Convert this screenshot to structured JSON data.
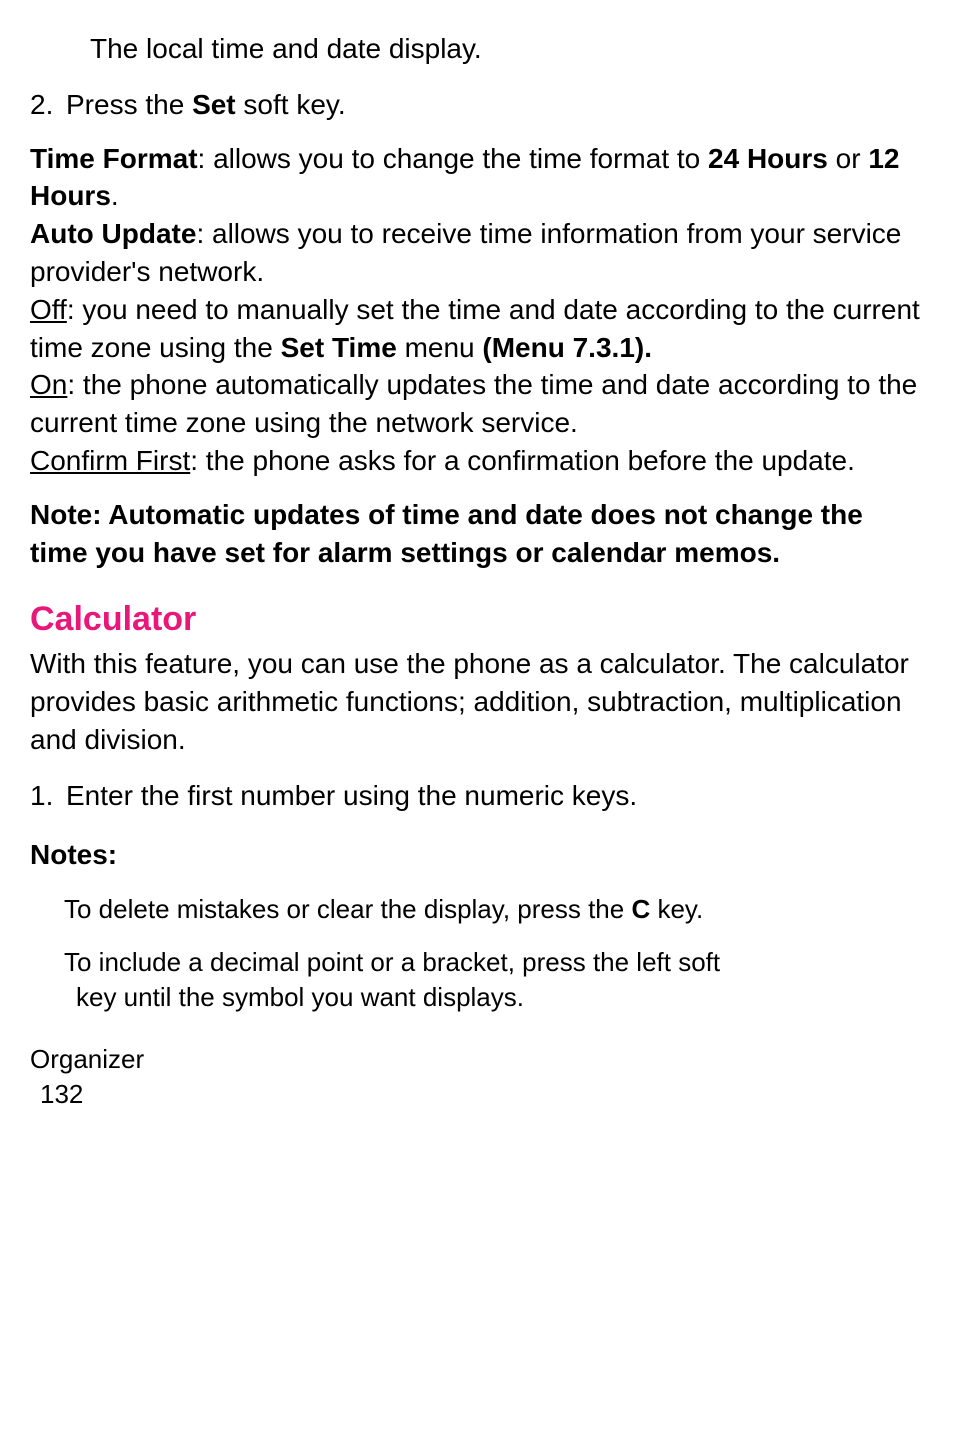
{
  "intro_line": "The local time and date display.",
  "step2": {
    "num": "2.",
    "prefix": "Press the ",
    "set": "Set",
    "suffix": " soft key."
  },
  "time_format": {
    "label": "Time Format",
    "text1": ": allows you to change the time format to ",
    "h24": "24 Hours",
    "or": " or ",
    "h12": "12 Hours",
    "period": "."
  },
  "auto_update": {
    "label": "Auto Update",
    "text": ": allows you to receive time information from your service provider's network."
  },
  "off": {
    "label": "Off",
    "text1": ": you need to manually set the time and date according to the current time zone using the ",
    "settime": "Set Time",
    "text2": " menu ",
    "menu": "(Menu 7.3.1)."
  },
  "on": {
    "label": "On",
    "text": ": the phone automatically updates the time and date according to the current time zone using the network service."
  },
  "confirm": {
    "label": "Confirm First",
    "text": ": the phone asks for a confirmation before the update."
  },
  "note_block": "Note:  Automatic updates of time and date does not change the time you have set for alarm settings or calendar memos.",
  "calculator": {
    "heading": "Calculator",
    "desc": "With this feature, you can use the phone as a calculator. The calculator provides basic arithmetic functions; addition, subtraction, multiplication and division."
  },
  "calc_step1": {
    "num": "1.",
    "text": "Enter the first number using the numeric keys."
  },
  "notes_heading": "Notes:",
  "note1": {
    "prefix": "To delete mistakes or clear the display, press the ",
    "c": "C",
    "suffix": " key."
  },
  "note2_line1": "To include a decimal point or a bracket, press the left soft",
  "note2_line2": "key until the symbol you want displays.",
  "footer": {
    "label": "Organizer",
    "page": "132"
  }
}
